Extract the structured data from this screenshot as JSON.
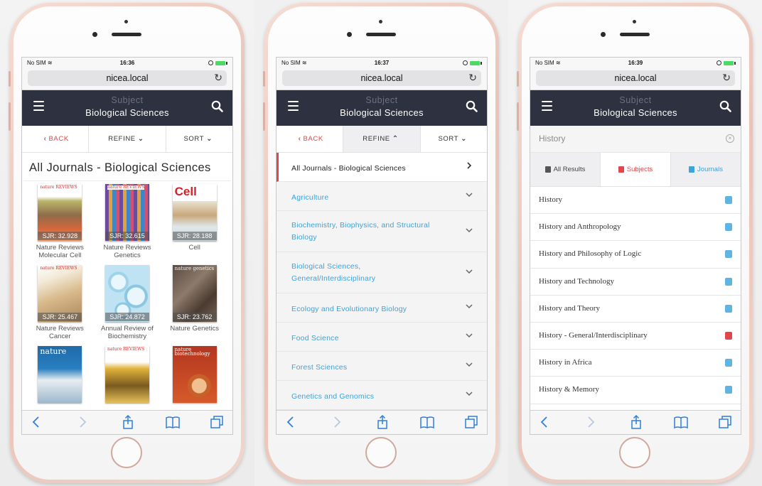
{
  "common": {
    "carrier": "No SIM",
    "url": "nicea.local",
    "subject_label": "Subject",
    "subject_title": "Biological Sciences",
    "colors": {
      "appbar": "#2d3140",
      "accent_red": "#e0474c",
      "accent_blue": "#3da3d8",
      "battery": "#4cd964"
    }
  },
  "screen1": {
    "time": "16:36",
    "toolbar": {
      "back": "BACK",
      "refine": "REFINE",
      "sort": "SORT"
    },
    "heading": "All Journals - Biological Sciences",
    "journals": [
      {
        "name": "Nature Reviews Molecular Cell",
        "sjr": "SJR: 32.928"
      },
      {
        "name": "Nature Reviews Genetics",
        "sjr": "SJR: 32.615"
      },
      {
        "name": "Cell",
        "sjr": "SJR: 28.188"
      },
      {
        "name": "Nature Reviews Cancer",
        "sjr": "SJR: 25.467"
      },
      {
        "name": "Annual Review of Biochemistry",
        "sjr": "SJR: 24.872"
      },
      {
        "name": "Nature Genetics",
        "sjr": "SJR: 23.762"
      },
      {
        "name": "",
        "sjr": ""
      },
      {
        "name": "",
        "sjr": ""
      },
      {
        "name": "",
        "sjr": ""
      }
    ],
    "cover_text": [
      "nature REVIEWS",
      "nature REVIEWS",
      "Cell",
      "nature REVIEWS",
      "",
      "nature genetics",
      "nature",
      "nature REVIEWS",
      "nature biotechnology"
    ]
  },
  "screen2": {
    "time": "16:37",
    "toolbar": {
      "back": "BACK",
      "refine": "REFINE",
      "sort": "SORT"
    },
    "categories": [
      "All Journals - Biological Sciences",
      "Agriculture",
      "Biochemistry, Biophysics, and Structural Biology",
      "Biological Sciences, General/Interdisciplinary",
      "Ecology and Evolutionary Biology",
      "Food Science",
      "Forest Sciences",
      "Genetics and Genomics"
    ]
  },
  "screen3": {
    "time": "16:39",
    "search_query": "History",
    "tabs": {
      "all": "All Results",
      "subjects": "Subjects",
      "journals": "Journals"
    },
    "results": [
      {
        "title": "History",
        "kind": "journal"
      },
      {
        "title": "History and Anthropology",
        "kind": "journal"
      },
      {
        "title": "History and Philosophy of Logic",
        "kind": "journal"
      },
      {
        "title": "History and Technology",
        "kind": "journal"
      },
      {
        "title": "History and Theory",
        "kind": "journal"
      },
      {
        "title": "History - General/Interdisciplinary",
        "kind": "subject"
      },
      {
        "title": "History in Africa",
        "kind": "journal"
      },
      {
        "title": "History & Memory",
        "kind": "journal"
      }
    ]
  }
}
